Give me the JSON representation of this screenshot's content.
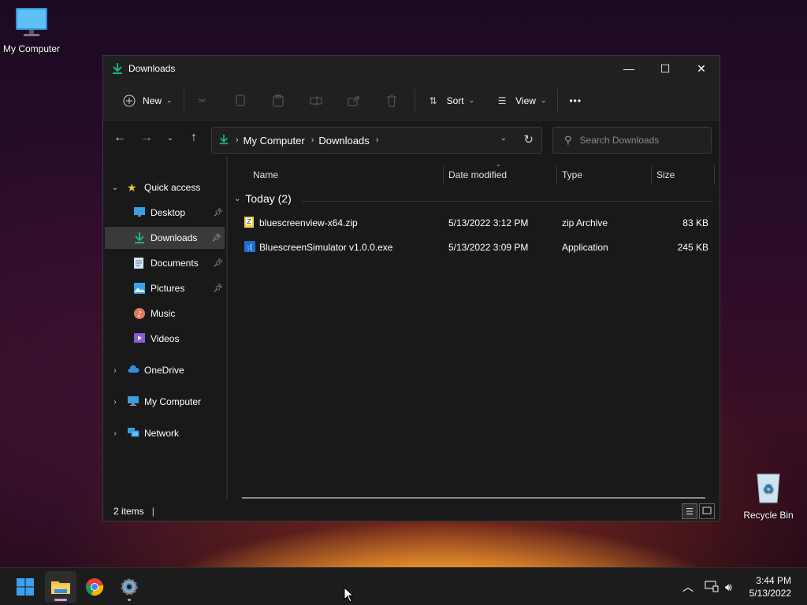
{
  "desktop": {
    "icons": [
      {
        "label": "My Computer"
      },
      {
        "label": "Recycle Bin"
      }
    ]
  },
  "window": {
    "title": "Downloads",
    "controls": {
      "minimize": "—",
      "maximize": "☐",
      "close": "✕"
    }
  },
  "commandbar": {
    "new_label": "New",
    "sort_label": "Sort",
    "view_label": "View",
    "more_label": "•••"
  },
  "address": {
    "crumbs": [
      "My Computer",
      "Downloads"
    ],
    "search_placeholder": "Search Downloads"
  },
  "nav": {
    "quick_access": "Quick access",
    "items": [
      {
        "label": "Desktop",
        "pinned": true
      },
      {
        "label": "Downloads",
        "pinned": true,
        "selected": true
      },
      {
        "label": "Documents",
        "pinned": true
      },
      {
        "label": "Pictures",
        "pinned": true
      },
      {
        "label": "Music",
        "pinned": false
      },
      {
        "label": "Videos",
        "pinned": false
      }
    ],
    "roots": [
      "OneDrive",
      "My Computer",
      "Network"
    ]
  },
  "columns": [
    "Name",
    "Date modified",
    "Type",
    "Size"
  ],
  "group": {
    "label": "Today (2)"
  },
  "files": [
    {
      "name": "bluescreenview-x64.zip",
      "date": "5/13/2022 3:12 PM",
      "type": "zip Archive",
      "size": "83 KB"
    },
    {
      "name": "BluescreenSimulator v1.0.0.exe",
      "date": "5/13/2022 3:09 PM",
      "type": "Application",
      "size": "245 KB"
    }
  ],
  "status": {
    "count": "2 items"
  },
  "taskbar": {
    "time": "3:44 PM",
    "date": "5/13/2022"
  },
  "colors": {
    "accent_download": "#1fb37a",
    "folder": "#f0c040",
    "window_bg": "#191919"
  }
}
